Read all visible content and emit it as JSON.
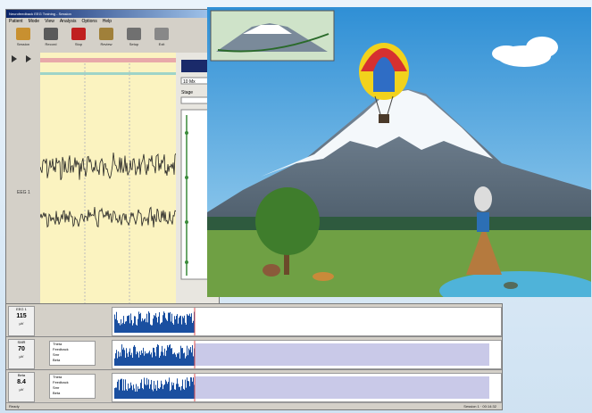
{
  "app": {
    "title": "Neurofeedback EEG Training - Session",
    "menu": [
      "Patient",
      "Mode",
      "View",
      "Analysis",
      "Options",
      "Help"
    ]
  },
  "toolbar": {
    "buttons": [
      {
        "label": "Session",
        "color": "#c89030"
      },
      {
        "label": "Record",
        "color": "#5a5a5a"
      },
      {
        "label": "Stop",
        "color": "#c02020"
      },
      {
        "label": "Review",
        "color": "#a0803a"
      },
      {
        "label": "Setup",
        "color": "#707070"
      },
      {
        "label": "Exit",
        "color": "#888888"
      }
    ]
  },
  "eeg": {
    "channel_label": "EEG 1"
  },
  "side": {
    "zoom_label": "10 Mx",
    "stage_label": "Stage"
  },
  "rows": [
    {
      "name": "EEG 1",
      "value": "115",
      "unit": "µV",
      "options": []
    },
    {
      "name": "SMR",
      "value": "70",
      "unit": "µV",
      "options": [
        "Theta",
        "Feedback",
        "Smr",
        "Beta"
      ]
    },
    {
      "name": "Beta",
      "value": "8.4",
      "unit": "µV",
      "options": [
        "Theta",
        "Feedback",
        "Smr",
        "Beta"
      ]
    }
  ],
  "status": {
    "left": "Ready",
    "right": "Session 1 · 00:14:32"
  },
  "colors": {
    "accent": "#1a4fa0",
    "eeg_bg": "#fbf3c0",
    "sky": "#2f8fd5"
  },
  "icons": {
    "balloon": "hot-air-balloon",
    "tree": "oak-tree",
    "tent": "tepee",
    "mountain": "snow-capped-volcano"
  }
}
